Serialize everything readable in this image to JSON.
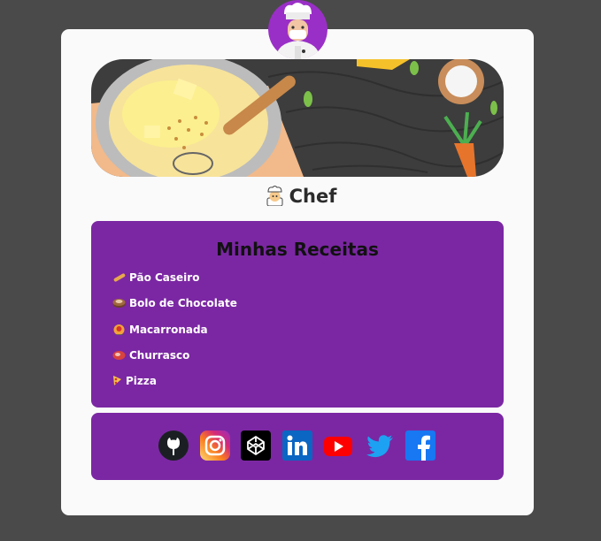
{
  "profile": {
    "avatar_icon": "chef-avatar-icon",
    "banner_image": "cooking-illustration",
    "title": "Chef",
    "title_icon": "chef-emoji-icon"
  },
  "recipes": {
    "heading": "Minhas Receitas",
    "items": [
      {
        "icon": "bread-icon",
        "label": "Pão Caseiro"
      },
      {
        "icon": "cake-icon",
        "label": "Bolo de Chocolate"
      },
      {
        "icon": "pasta-icon",
        "label": "Macarronada"
      },
      {
        "icon": "meat-icon",
        "label": "Churrasco"
      },
      {
        "icon": "pizza-icon",
        "label": "Pizza"
      }
    ]
  },
  "social": {
    "links": [
      "github-icon",
      "instagram-icon",
      "codepen-icon",
      "linkedin-icon",
      "youtube-icon",
      "twitter-icon",
      "facebook-icon"
    ]
  },
  "colors": {
    "background": "#4a4a4a",
    "card": "#fafafa",
    "panel": "#7b27a3",
    "accent": "#9a2fc7"
  }
}
